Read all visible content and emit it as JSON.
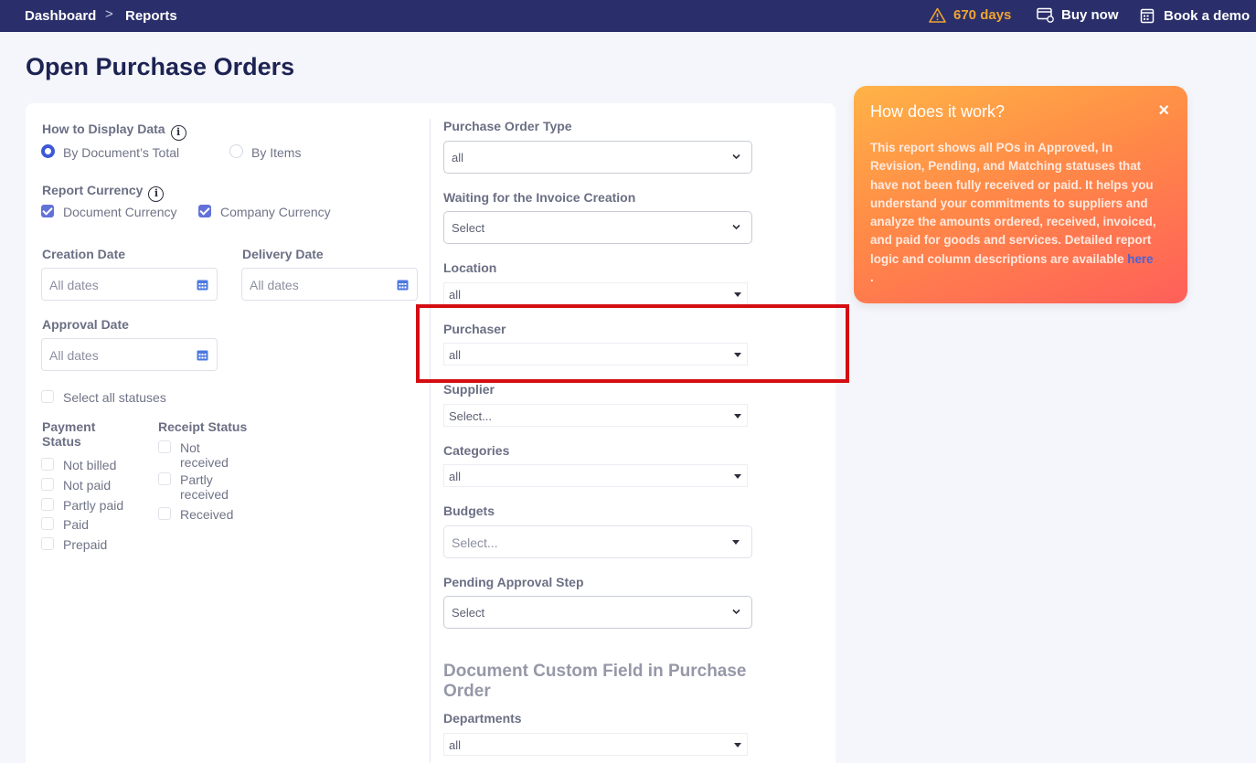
{
  "topbar": {
    "breadcrumb": [
      "Dashboard",
      "Reports"
    ],
    "separator": ">",
    "trial": "670 days",
    "buy_now": "Buy now",
    "book_demo": "Book a demo"
  },
  "page": {
    "title": "Open Purchase Orders"
  },
  "left": {
    "display": {
      "label": "How to Display Data",
      "info": "i",
      "options": [
        "By Document’s Total",
        "By Items"
      ],
      "selected": "By Document’s Total"
    },
    "currency": {
      "label": "Report Currency",
      "info": "i",
      "options": [
        "Document Currency",
        "Company Currency"
      ]
    },
    "creation_date": {
      "label": "Creation Date",
      "placeholder": "All dates"
    },
    "delivery_date": {
      "label": "Delivery Date",
      "placeholder": "All dates"
    },
    "approval_date": {
      "label": "Approval Date",
      "placeholder": "All dates"
    },
    "select_all_statuses": "Select all statuses",
    "payment_status": {
      "label": "Payment Status",
      "items": [
        "Not billed",
        "Not paid",
        "Partly paid",
        "Paid",
        "Prepaid"
      ]
    },
    "receipt_status": {
      "label": "Receipt Status",
      "items": [
        "Not received",
        "Partly received",
        "Received"
      ]
    }
  },
  "right": {
    "po_type": {
      "label": "Purchase Order Type",
      "value": "all"
    },
    "waiting_invoice": {
      "label": "Waiting for the Invoice Creation",
      "value": "Select"
    },
    "location": {
      "label": "Location",
      "value": "all"
    },
    "purchaser": {
      "label": "Purchaser",
      "value": "all"
    },
    "supplier": {
      "label": "Supplier",
      "value": "Select..."
    },
    "categories": {
      "label": "Categories",
      "value": "all"
    },
    "budgets": {
      "label": "Budgets",
      "value": "Select..."
    },
    "pending_step": {
      "label": "Pending Approval Step",
      "value": "Select"
    },
    "custom_section": "Document Custom Field in Purchase Order",
    "departments": {
      "label": "Departments",
      "value": "all"
    }
  },
  "help": {
    "title": "How does it work?",
    "close": "×",
    "body": "This report shows all POs in Approved, In Revision, Pending, and Matching statuses that have not been fully received or paid. It helps you understand your commitments to suppliers and analyze the amounts ordered, received, invoiced, and paid for goods and services. Detailed report logic and column descriptions are available ",
    "link": "here",
    "tail": " ."
  },
  "colors": {
    "topbar": "#2a2f6b",
    "accent": "#3e59d6",
    "highlight": "#d40d12",
    "warning": "#f0a431"
  }
}
